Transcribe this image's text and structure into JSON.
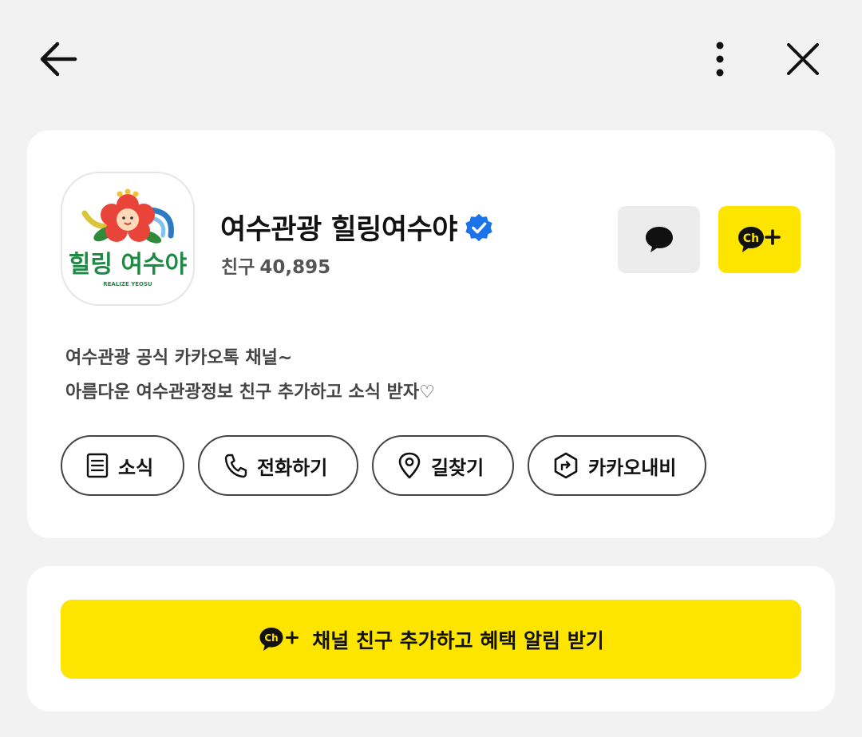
{
  "channel": {
    "name": "여수관광 힐링여수야",
    "friends_label": "친구",
    "friends_count": "40,895",
    "logo_text": "힐링 여수야",
    "logo_subtext": "REALIZE YEOSU"
  },
  "description": {
    "line1": "여수관광 공식 카카오톡 채널~",
    "line2": "아름다운 여수관광정보 친구 추가하고 소식 받자♡"
  },
  "actions": [
    {
      "label": "소식",
      "icon": "document-icon"
    },
    {
      "label": "전화하기",
      "icon": "phone-icon"
    },
    {
      "label": "길찾기",
      "icon": "location-pin-icon"
    },
    {
      "label": "카카오내비",
      "icon": "navi-icon"
    }
  ],
  "cta": {
    "label": "채널 친구 추가하고 혜택 알림 받기",
    "badge_text": "Ch"
  },
  "colors": {
    "accent": "#fee500",
    "verified": "#1a73e8",
    "background": "#f2f2f2"
  }
}
